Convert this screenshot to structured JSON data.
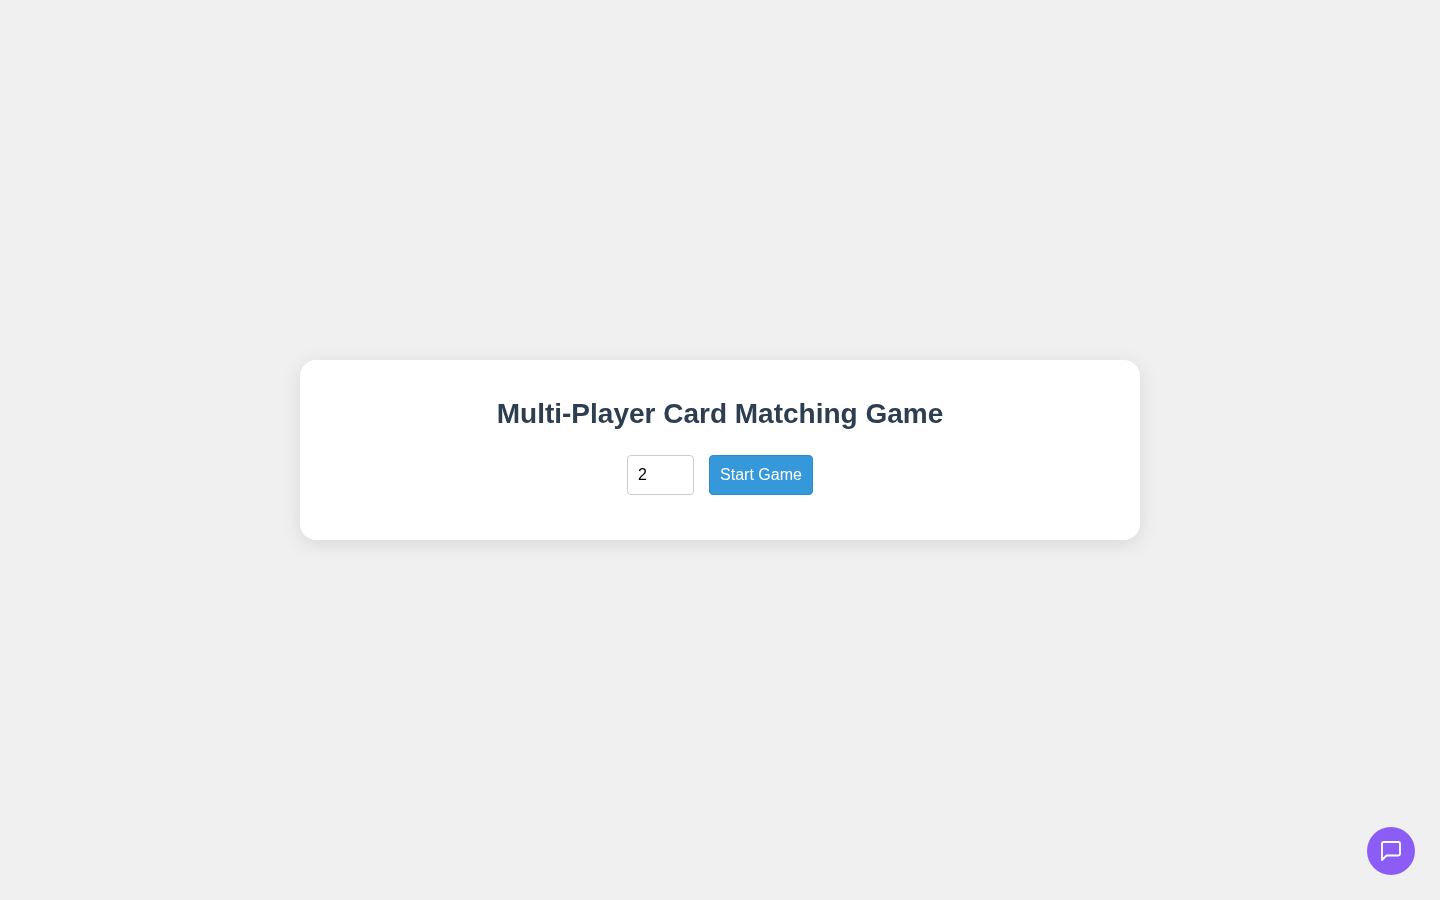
{
  "title": "Multi-Player Card Matching Game",
  "player_count": {
    "value": "2"
  },
  "start_button": {
    "label": "Start Game"
  }
}
